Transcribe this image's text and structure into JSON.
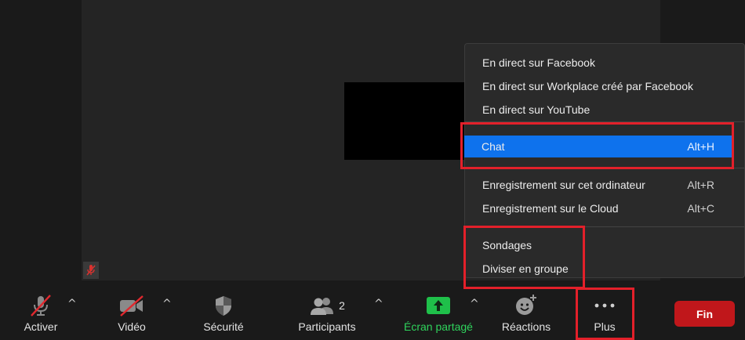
{
  "colors": {
    "accent": "#0e72ed",
    "end": "#c0171b",
    "share": "#2fd35c",
    "highlight": "#e3202a"
  },
  "toolbar": {
    "mute_label": "Activer",
    "video_label": "Vidéo",
    "security_label": "Sécurité",
    "participants_label": "Participants",
    "participants_count": "2",
    "share_label": "Écran partagé",
    "reactions_label": "Réactions",
    "more_label": "Plus",
    "end_label": "Fin"
  },
  "menu": {
    "items": [
      {
        "label": "En direct sur Facebook",
        "shortcut": ""
      },
      {
        "label": "En direct sur Workplace créé par Facebook",
        "shortcut": ""
      },
      {
        "label": "En direct sur YouTube",
        "shortcut": ""
      },
      {
        "label": "Chat",
        "shortcut": "Alt+H"
      },
      {
        "label": "Enregistrement sur cet ordinateur",
        "shortcut": "Alt+R"
      },
      {
        "label": "Enregistrement sur le Cloud",
        "shortcut": "Alt+C"
      },
      {
        "label": "Sondages",
        "shortcut": ""
      },
      {
        "label": "Diviser en groupe",
        "shortcut": ""
      }
    ]
  }
}
